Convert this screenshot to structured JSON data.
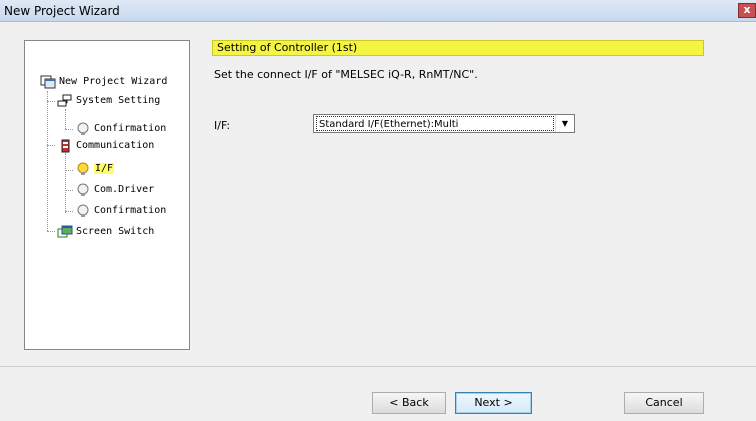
{
  "window": {
    "title": "New Project Wizard",
    "close_label": "x"
  },
  "tree": {
    "items": [
      {
        "label": "New Project Wizard",
        "icon": "wizard-icon"
      },
      {
        "label": "System Setting",
        "icon": "system-icon"
      },
      {
        "label": "Confirmation",
        "icon": "bulb-icon"
      },
      {
        "label": "Communication",
        "icon": "communication-icon"
      },
      {
        "label": "I/F",
        "icon": "bulb-lit-icon",
        "selected": true
      },
      {
        "label": "Com.Driver",
        "icon": "bulb-icon"
      },
      {
        "label": "Confirmation",
        "icon": "bulb-icon"
      },
      {
        "label": "Screen Switch",
        "icon": "screen-switch-icon"
      }
    ]
  },
  "main": {
    "header": "Setting of Controller (1st)",
    "description": "Set the connect I/F of \"MELSEC iQ-R, RnMT/NC\".",
    "if_label": "I/F:",
    "if_value": "Standard I/F(Ethernet):Multi"
  },
  "buttons": {
    "back": "< Back",
    "next": "Next >",
    "cancel": "Cancel"
  },
  "colors": {
    "header_bg": "#f4f442",
    "selected_bg": "#ffff66",
    "title_bar": "#c7d8ee"
  }
}
